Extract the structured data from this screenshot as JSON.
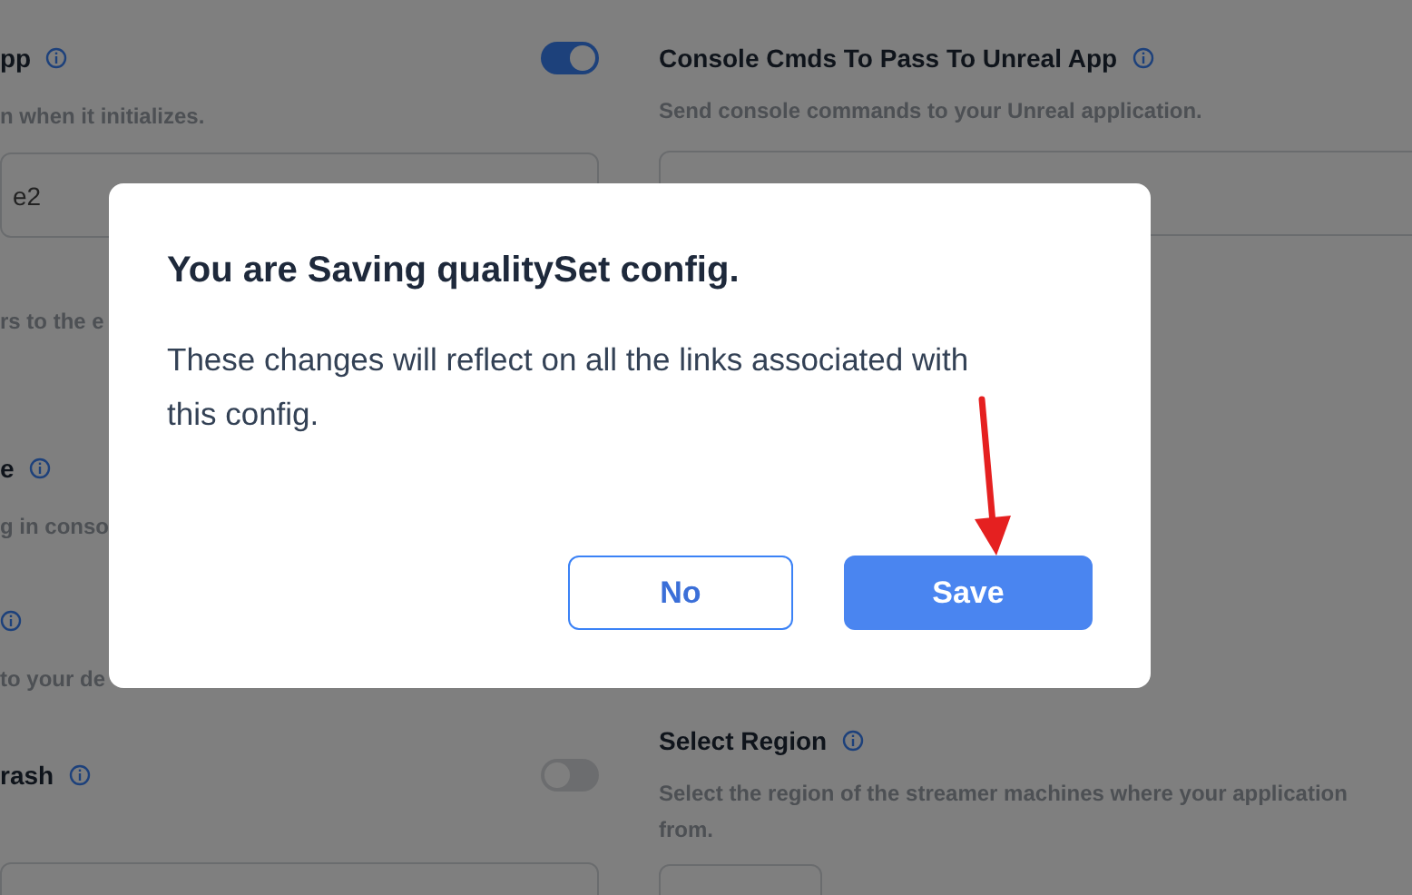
{
  "left_fields": [
    {
      "title": "pp",
      "info": true,
      "toggle": {
        "on": true
      },
      "description": "n when it initializes.",
      "input": {
        "kind": "text",
        "value": "e2"
      }
    },
    {
      "description": "rs to the e"
    },
    {
      "title": "e",
      "info": true,
      "description": "g in conso"
    },
    {
      "info": true,
      "description": "to your de"
    },
    {
      "title": "rash",
      "info": true,
      "toggle": {
        "on": false
      },
      "input": {
        "kind": "text"
      }
    }
  ],
  "right_fields": [
    {
      "title": "Console Cmds To Pass To Unreal App",
      "info": true,
      "description_lines": [
        "Send console commands to your Unreal application."
      ],
      "input": {
        "kind": "text"
      }
    },
    {
      "title": "Select Region",
      "info": true,
      "description_lines": [
        "Select the region of the streamer machines where your application",
        "from."
      ],
      "input": {
        "kind": "select"
      }
    }
  ],
  "dialog": {
    "title": "You are Saving qualitySet config.",
    "body": "These changes will reflect on all the links associated with this config.",
    "buttons": [
      {
        "label": "No",
        "kind": "secondary"
      },
      {
        "label": "Save",
        "kind": "primary"
      }
    ]
  },
  "annotation": {
    "kind": "arrow"
  }
}
